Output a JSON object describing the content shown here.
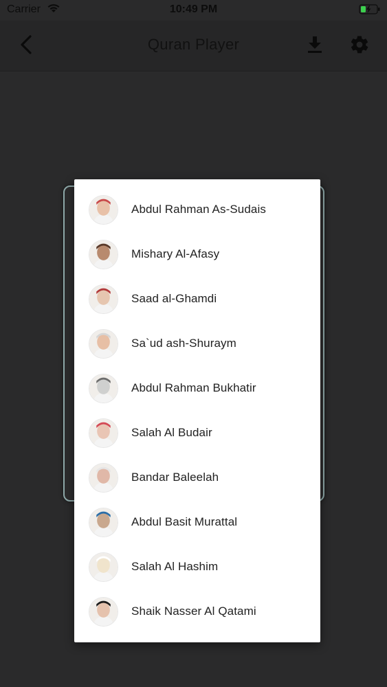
{
  "status_bar": {
    "carrier": "Carrier",
    "time": "10:49 PM"
  },
  "nav": {
    "title": "Quran Player",
    "back_icon": "chevron-left-icon",
    "download_icon": "download-icon",
    "settings_icon": "gear-icon"
  },
  "colors": {
    "background": "#2a2a2b",
    "popup": "#ffffff",
    "card_border": "#8fa9a9",
    "text": "#222222"
  },
  "reciters": [
    {
      "name": "Abdul Rahman As-Sudais"
    },
    {
      "name": "Mishary Al-Afasy"
    },
    {
      "name": "Saad al-Ghamdi"
    },
    {
      "name": "Sa`ud ash-Shuraym"
    },
    {
      "name": "Abdul Rahman Bukhatir"
    },
    {
      "name": "Salah Al Budair"
    },
    {
      "name": "Bandar Baleelah"
    },
    {
      "name": "Abdul Basit Murattal"
    },
    {
      "name": "Salah Al Hashim"
    },
    {
      "name": "Shaik Nasser Al Qatami"
    }
  ]
}
